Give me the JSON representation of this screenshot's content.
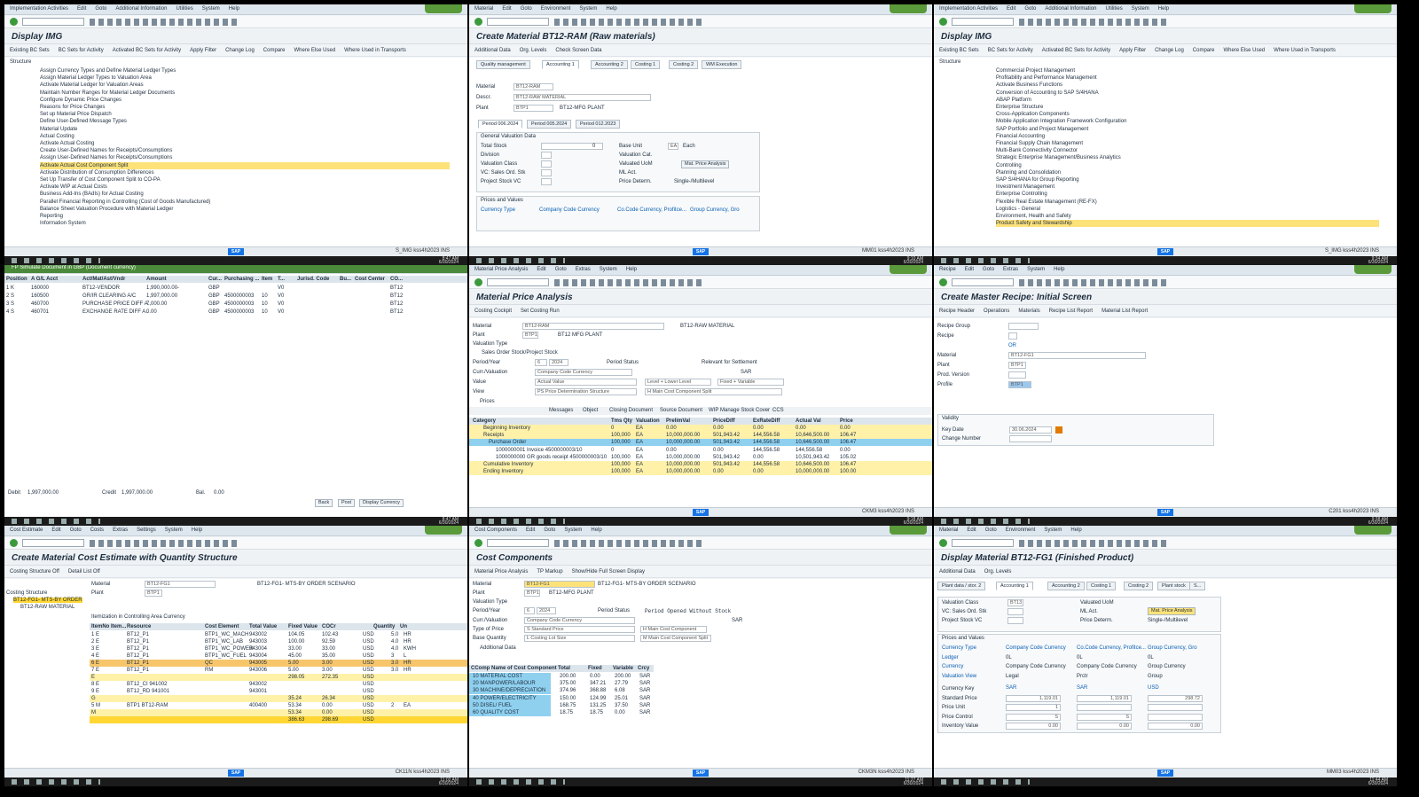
{
  "panes": [
    {
      "menu": [
        "Implementation Activities",
        "Edit",
        "Goto",
        "Additional Information",
        "Utilities",
        "System",
        "Help"
      ],
      "title": "Display IMG",
      "appbar": [
        "Existing BC Sets",
        "BC Sets for Activity",
        "Activated BC Sets for Activity",
        "Apply Filter",
        "Change Log",
        "Compare",
        "Where Else Used",
        "Where Used in Transports"
      ],
      "structure_label": "Structure",
      "tree": [
        "Assign Currency Types and Define Material Ledger Types",
        "Assign Material Ledger Types to Valuation Area",
        "Activate Material Ledger for Valuation Areas",
        "Maintain Number Ranges for Material Ledger Documents",
        "Configure Dynamic Price Changes",
        "Reasons for Price Changes",
        "Set up Material Price Dispatch",
        "Define User-Defined Message Types",
        "Material Update",
        "Actual Costing",
        "Activate Actual Costing",
        "Create User-Defined Names for Receipts/Consumptions",
        "Assign User-Defined Names for Receipts/Consumptions",
        "Activate Actual Cost Component Split",
        "Activate Distribution of Consumption Differences",
        "Set Up Transfer of Cost Component Split to CO-PA",
        "Activate WIP at Actual Costs",
        "Business Add-Ins (BAdIs) for Actual Costing",
        "Parallel Financial Reporting in Controlling (Cost of Goods Manufactured)",
        "Balance Sheet Valuation Procedure with Material Ledger",
        "Reporting",
        "Information System"
      ],
      "tree_highlight": 13,
      "status": "S_IMG",
      "user": "kss4h2023",
      "mode": "INS",
      "time": "8:47 AM",
      "date": "6/30/2024"
    },
    {
      "menu": [
        "Material",
        "Edit",
        "Goto",
        "Environment",
        "System",
        "Help"
      ],
      "title": "Create Material BT12-RAM (Raw materials)",
      "appbar": [
        "Additional Data",
        "Org. Levels",
        "Check Screen Data"
      ],
      "tabs": [
        "Quality management",
        "Accounting 1",
        "Accounting 2",
        "Costing 1",
        "Costing 2",
        "WM Execution"
      ],
      "material_label": "Material",
      "material": "BT12-RAM",
      "descr_label": "Descr.",
      "descr": "BT12-RAW MATERIAL",
      "plant_label": "Plant",
      "plant": "BTP1",
      "plant_name": "BT12-MFG PLANT",
      "periods": [
        "Period 006.2024",
        "Period 005.2024",
        "Period 012.2023"
      ],
      "gv_title": "General Valuation Data",
      "gv_fields": [
        "Total Stock",
        "Division",
        "Valuation Class",
        "VC: Sales Ord. Stk",
        "Project Stock VC"
      ],
      "total_stock": "0",
      "gv_right": [
        "Base Unit",
        "Valuation Cat.",
        "Valuated UoM",
        "ML Act.",
        "Price Determ."
      ],
      "base_unit": "EA",
      "base_unit_text": "Each",
      "price_det": "Single-/Multilevel",
      "mat_price_btn": "Mat. Price Analysis",
      "pv_title": "Prices and Values",
      "currency_type": "Currency Type",
      "ccc": "Company Code Currency",
      "ccc2": "Co.Code Currency, Profitce...",
      "grp": "Group Currency, Gro",
      "status": "MM01",
      "user": "kss4h2023",
      "mode": "INS",
      "time": "9:10 AM",
      "date": "6/30/2024"
    },
    {
      "menu": [
        "Implementation Activities",
        "Edit",
        "Goto",
        "Additional Information",
        "Utilities",
        "System",
        "Help"
      ],
      "title": "Display IMG",
      "appbar": [
        "Existing BC Sets",
        "BC Sets for Activity",
        "Activated BC Sets for Activity",
        "Apply Filter",
        "Change Log",
        "Compare",
        "Where Else Used",
        "Where Used in Transports"
      ],
      "structure_label": "Structure",
      "tree": [
        "Commercial Project Management",
        "Profitability and Performance Management",
        "Activate Business Functions",
        "Conversion of Accounting to SAP S/4HANA",
        "ABAP Platform",
        "Enterprise Structure",
        "Cross-Application Components",
        "Mobile Application Integration Framework Configuration",
        "SAP Portfolio and Project Management",
        "Financial Accounting",
        "Financial Supply Chain Management",
        "Multi-Bank Connectivity Connector",
        "Strategic Enterprise Management/Business Analytics",
        "Controlling",
        "Planning and Consolidation",
        "SAP S/4HANA for Group Reporting",
        "Investment Management",
        "Enterprise Controlling",
        "Flexible Real Estate Management (RE-FX)",
        "Logistics - General",
        "Environment, Health and Safety",
        "Product Safety and Stewardship"
      ],
      "tree_highlight": 21,
      "status": "S_IMG",
      "user": "kss4h2023",
      "mode": "INS",
      "time": "9:34 AM",
      "date": "6/30/2024"
    },
    {
      "title": "FP Simulate Document in GBP (Document currency)",
      "headers": [
        "Position",
        "A G/L Acct",
        "Act/Mat/Ast/Vndr",
        "Amount",
        "Cur...",
        "Purchasing ...",
        "Item",
        "T...",
        "Jurisd. Code",
        "Bu...",
        "Cost Center",
        "CO..."
      ],
      "rows": [
        [
          "1 K",
          "160000",
          "BT12-VENDOR",
          "1,990,000.00-",
          "GBP",
          "",
          "",
          "V0",
          "",
          "",
          "",
          "BT12"
        ],
        [
          "2 S",
          "160500",
          "GR/IR CLEARING A/C",
          "1,997,000.00",
          "GBP",
          "4500000003",
          "10",
          "V0",
          "",
          "",
          "",
          "BT12"
        ],
        [
          "3 S",
          "460700",
          "PURCHASE PRICE DIFF A..",
          "7,000.00",
          "GBP",
          "4500000003",
          "10",
          "V0",
          "",
          "",
          "",
          "BT12"
        ],
        [
          "4 S",
          "460701",
          "EXCHANGE RATE DIFF A..",
          "0.00",
          "GBP",
          "4500000003",
          "10",
          "V0",
          "",
          "",
          "",
          "BT12"
        ]
      ],
      "debit_label": "Debit",
      "debit": "1,997,000.00",
      "credit_label": "Credit",
      "credit": "1,997,000.00",
      "bal_label": "Bal.",
      "bal": "0.00",
      "buttons": [
        "Back",
        "Post",
        "Display Currency"
      ],
      "time": "8:47 AM",
      "date": "6/30/2024"
    },
    {
      "menu": [
        "Material Price Analysis",
        "Edit",
        "Goto",
        "Extras",
        "System",
        "Help"
      ],
      "title": "Material Price Analysis",
      "appbar": [
        "Costing Cockpit",
        "Set Costing Run"
      ],
      "material_label": "Material",
      "material": "BT12-RAM",
      "material_name": "BT12-RAW MATERIAL",
      "plant_label": "Plant",
      "plant": "BTP1",
      "plant_name": "BT12 MFG PLANT",
      "valtype_label": "Valuation Type",
      "sales_label": "Sales Order Stock/Project Stock",
      "period_label": "Period/Year",
      "period": "6",
      "year": "2024",
      "period_status_label": "Period Status",
      "period_status": "Relevant for Settlement",
      "curr_label": "Curr./Valuation",
      "curr": "Company Code Currency",
      "curr_code": "SAR",
      "value_label": "Value",
      "value": "Actual Value",
      "value2": "Level + Lower Level",
      "value3": "Fixed + Variable",
      "view_label": "View",
      "view": "PS Price Determination Structure",
      "view2": "H Main Cost Component Split",
      "prices_label": "Prices",
      "ptoolbar": [
        "Messages",
        "Object",
        "Closing Document",
        "Source Document",
        "WIP",
        "Manage Stock Cover",
        "CCS"
      ],
      "cols": [
        "Category",
        "Tms Qty",
        "Valuation",
        "PrelimVal",
        "PriceDiff",
        "ExRateDiff",
        "Actual Val",
        "Price"
      ],
      "rows": [
        [
          "Beginning Inventory",
          "0",
          "EA",
          "0.00",
          "0.00",
          "0.00",
          "0.00",
          "0.00"
        ],
        [
          "Receipts",
          "100,000",
          "EA",
          "10,000,000.00",
          "501,943.42",
          "144,556.58",
          "10,646,500.00",
          "106.47"
        ],
        [
          "Purchase Order",
          "100,000",
          "EA",
          "10,000,000.00",
          "501,943.42",
          "144,556.58",
          "10,646,500.00",
          "106.47"
        ],
        [
          "1000000001 Invoice 4500000003/10",
          "0",
          "EA",
          "0.00",
          "0.00",
          "144,556.58",
          "144,556.58",
          "0.00"
        ],
        [
          "1000000000 GR goods receipt 4500000003/10",
          "100,000",
          "EA",
          "10,000,000.00",
          "501,943.42",
          "0.00",
          "10,501,943.42",
          "105.02"
        ],
        [
          "Cumulative Inventory",
          "100,000",
          "EA",
          "10,000,000.00",
          "501,943.42",
          "144,556.58",
          "10,646,500.00",
          "106.47"
        ],
        [
          "Ending Inventory",
          "100,000",
          "EA",
          "10,000,000.00",
          "0.00",
          "0.00",
          "10,000,000.00",
          "100.00"
        ]
      ],
      "status": "CKM3",
      "user": "kss4h2023",
      "mode": "INS",
      "time": "9:18 AM",
      "date": "6/30/2024"
    },
    {
      "menu": [
        "Recipe",
        "Edit",
        "Goto",
        "Extras",
        "System",
        "Help"
      ],
      "title": "Create Master Recipe: Initial Screen",
      "appbar": [
        "Recipe Header",
        "Operations",
        "Materials",
        "Recipe List Report",
        "Material List Report"
      ],
      "fields": [
        "Recipe Group",
        "Recipe",
        "",
        "Material",
        "Plant",
        "Prod. Version",
        "Profile"
      ],
      "or_text": "OR",
      "material": "BT12-FG1",
      "plant": "BTP1",
      "profile": "BTP1",
      "validity_label": "Validity",
      "key_date_label": "Key Date",
      "key_date": "30.06.2024",
      "change_label": "Change Number",
      "status": "C201",
      "user": "kss4h2023",
      "mode": "INS",
      "time": "9:38 AM",
      "date": "6/30/2024"
    },
    {
      "menu": [
        "Cost Estimate",
        "Edit",
        "Goto",
        "Costs",
        "Extras",
        "Settings",
        "System",
        "Help"
      ],
      "title": "Create Material Cost Estimate with Quantity Structure",
      "appbar": [
        "Costing Structure Off",
        "Detail List Off"
      ],
      "material_label": "Material",
      "material": "BT12-FG1",
      "material_name": "BT12-FG1- MTS-BY ORDER SCENARIO",
      "plant_label": "Plant",
      "plant": "BTP1",
      "structure_label": "Costing Structure",
      "tree": [
        "BT12-FG1- MTS-BY ORDER",
        "BT12-RAW MATERIAL"
      ],
      "item_title": "Itemization in Controlling Area Currency",
      "cols": [
        "ItemNo Item...",
        "Resource",
        "Cost Element",
        "Total Value",
        "Fixed Value",
        "COCr",
        "Quantity",
        "Un"
      ],
      "rows": [
        [
          "1 E",
          "BT12_P1",
          "BTP1_WC_MACH",
          "943002",
          "104.05",
          "102.43",
          "USD",
          "5.0",
          "HR"
        ],
        [
          "2 E",
          "BT12_P1",
          "BTP1_WC_LAB",
          "943003",
          "100.00",
          "92.59",
          "USD",
          "4.0",
          "HR"
        ],
        [
          "3 E",
          "BT12_P1",
          "BTP1_WC_POWER",
          "943004",
          "33.00",
          "33.00",
          "USD",
          "4.0",
          "KWH"
        ],
        [
          "4 E",
          "BT12_P1",
          "BTP1_WC_FUEL",
          "943004",
          "45.00",
          "35.00",
          "USD",
          "3",
          "L"
        ],
        [
          "6 E",
          "BT12_P1",
          "QC",
          "943005",
          "5.00",
          "3.00",
          "USD",
          "3.0",
          "HR"
        ],
        [
          "7 E",
          "BT12_P1",
          "RM",
          "943006",
          "5.00",
          "3.00",
          "USD",
          "3.0",
          "HR"
        ],
        [
          "E",
          "",
          "",
          "",
          "298.05",
          "272.35",
          "USD",
          "",
          ""
        ],
        [
          "8 E",
          "BT12_CI 941002",
          "",
          "943002",
          "",
          "",
          "USD",
          "",
          ""
        ],
        [
          "9 E",
          "BT12_RD 941001",
          "",
          "943001",
          "",
          "",
          "USD",
          "",
          ""
        ],
        [
          "G",
          "",
          "",
          "",
          "35.24",
          "26.34",
          "USD",
          "",
          ""
        ],
        [
          "5 M",
          "BTP1 BT12-RAM",
          "",
          "400400",
          "53.34",
          "0.00",
          "USD",
          "2",
          "EA"
        ],
        [
          "M",
          "",
          "",
          "",
          "53.34",
          "0.00",
          "USD",
          "",
          ""
        ],
        [
          "",
          "",
          "",
          "",
          "386.63",
          "298.69",
          "USD",
          "",
          ""
        ]
      ],
      "status": "CK11N",
      "user": "kss4h2023",
      "mode": "INS",
      "time": "11:02 AM",
      "date": "6/30/2024"
    },
    {
      "menu": [
        "Cost Components",
        "Edit",
        "Goto",
        "System",
        "Help"
      ],
      "title": "Cost Components",
      "appbar": [
        "Material Price Analysis",
        "TP Markup",
        "Show/Hide Full Screen Display"
      ],
      "material_label": "Material",
      "material": "BT12-FG1",
      "material_name": "BT12-FG1- MTS-BY ORDER SCENARIO",
      "plant_label": "Plant",
      "plant": "BTP1",
      "plant_name": "BT12-MFG PLANT",
      "valtype_label": "Valuation Type",
      "period_label": "Period/Year",
      "period": "6",
      "year": "2024",
      "period_status_label": "Period Status",
      "period_status": "Period Opened Without Stock",
      "curr_label": "Curr./Valuation",
      "curr": "Company Code Currency",
      "curr_code": "SAR",
      "type_label": "Type of Price",
      "type": "S Standard Price",
      "type2": "H Main Cost Component",
      "base_label": "Base Quantity",
      "base": "L Costing Lot Size",
      "base2": "M Main Cost Component Split",
      "addl": "Additional Data",
      "cols": [
        "CComp Name of Cost Component",
        "Total",
        "Fixed",
        "Variable",
        "Crcy"
      ],
      "rows": [
        [
          "10 MATERIAL COST",
          "200.00",
          "0.00",
          "200.00",
          "SAR"
        ],
        [
          "20 MANPOWER/LABOUR",
          "375.00",
          "347.21",
          "27.79",
          "SAR"
        ],
        [
          "30 MACHINE/DEPRECIATION",
          "374.96",
          "368.88",
          "6.08",
          "SAR"
        ],
        [
          "40 POWER/ELECTRICITY",
          "150.00",
          "124.99",
          "25.01",
          "SAR"
        ],
        [
          "50 DISEL/ FUEL",
          "168.75",
          "131.25",
          "37.50",
          "SAR"
        ],
        [
          "60 QUALITY COST",
          "18.75",
          "18.75",
          "0.00",
          "SAR"
        ]
      ],
      "status": "CKM3N",
      "user": "kss4h2023",
      "mode": "INS",
      "time": "11:27 AM",
      "date": "6/30/2024"
    },
    {
      "menu": [
        "Material",
        "Edit",
        "Goto",
        "Environment",
        "System",
        "Help"
      ],
      "title": "Display Material BT12-FG1 (Finished Product)",
      "appbar": [
        "Additional Data",
        "Org. Levels"
      ],
      "tabs": [
        "Plant data / stor. 2",
        "Accounting 1",
        "Accounting 2",
        "Costing 1",
        "Costing 2",
        "Plant stock",
        "S..."
      ],
      "fields": [
        "Valuation Class",
        "VC: Sales Ord. Stk",
        "Project Stock VC"
      ],
      "val_class": "BT13",
      "right": [
        "Valuated UoM",
        "ML Act.",
        "Price Determ."
      ],
      "price_det": "Single-/Multilevel",
      "mat_price_btn": "Mat. Price Analysis",
      "pv_title": "Prices and Values",
      "pv_rows": [
        "Currency Type",
        "Ledger",
        "Currency",
        "Valuation View"
      ],
      "c1": [
        "Company Code Currency",
        "0L",
        "Company Code Currency",
        "Legal"
      ],
      "c2": [
        "Co.Code Currency, Profitce...",
        "0L",
        "Company Code Currency",
        "Prctr"
      ],
      "c3": [
        "Group Currency, Gro",
        "0L",
        "Group Currency",
        "Group"
      ],
      "ck_rows": [
        "Currency Key",
        "Standard Price",
        "Price Unit",
        "Price Control",
        "Inventory Value"
      ],
      "k1": [
        "SAR",
        "1,119.01",
        "1",
        "S",
        "0.00"
      ],
      "k2": [
        "SAR",
        "1,119.01",
        "",
        "S",
        "0.00"
      ],
      "k3": [
        "USD",
        "298.72",
        "",
        "",
        "0.00"
      ],
      "status": "MM03",
      "user": "kss4h2023",
      "mode": "INS",
      "time": "11:44 AM",
      "date": "6/30/2024"
    }
  ]
}
